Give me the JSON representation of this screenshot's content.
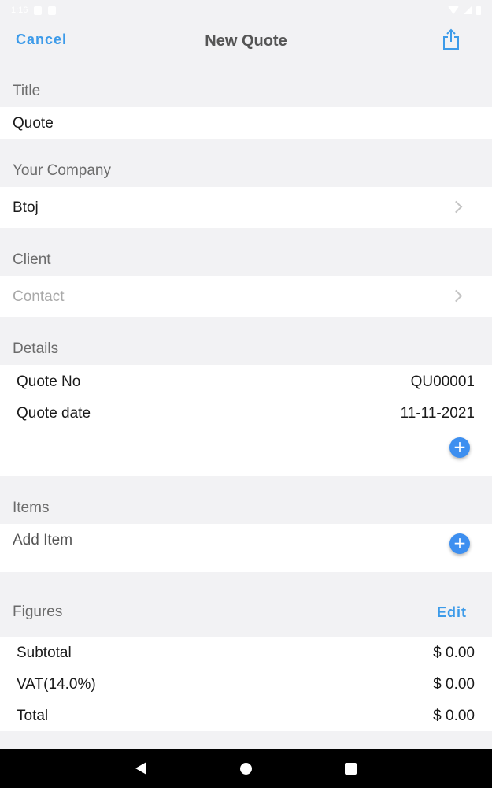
{
  "status_bar": {
    "time": "1:16"
  },
  "nav": {
    "cancel_label": "Cancel",
    "title": "New Quote",
    "share_icon": "share-icon"
  },
  "title_section": {
    "header": "Title",
    "value": "Quote"
  },
  "company_section": {
    "header": "Your Company",
    "value": "Btoj"
  },
  "client_section": {
    "header": "Client",
    "placeholder": "Contact"
  },
  "details_section": {
    "header": "Details",
    "rows": [
      {
        "label": "Quote No",
        "value": "QU00001"
      },
      {
        "label": "Quote date",
        "value": "11-11-2021"
      }
    ]
  },
  "items_section": {
    "header": "Items",
    "add_label": "Add Item"
  },
  "figures_section": {
    "header": "Figures",
    "edit_label": "Edit",
    "rows": [
      {
        "label": "Subtotal",
        "value": "$ 0.00"
      },
      {
        "label": "VAT(14.0%)",
        "value": "$ 0.00"
      },
      {
        "label": "Total",
        "value": "$ 0.00"
      }
    ]
  },
  "colors": {
    "accent": "#3d9be9",
    "plus_button": "#3d8ff0",
    "background": "#f2f2f4"
  }
}
